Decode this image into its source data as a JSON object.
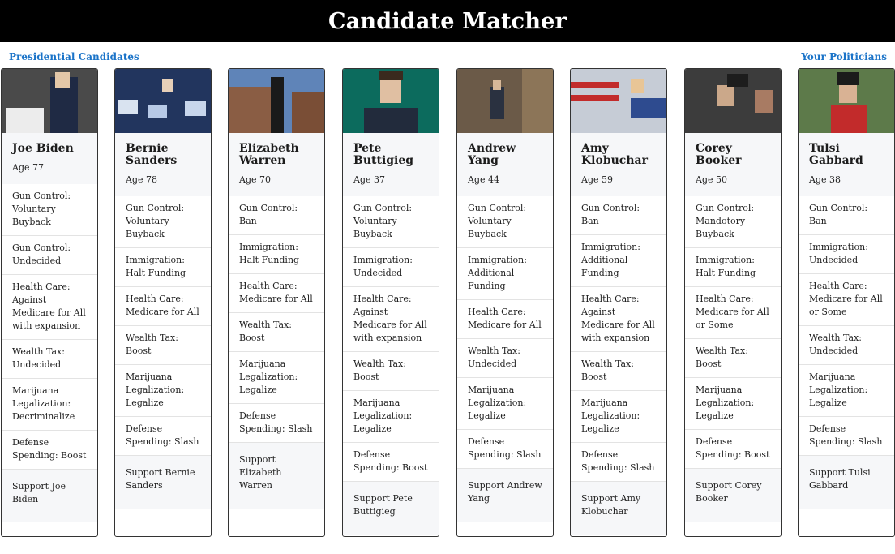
{
  "app": {
    "title": "Candidate Matcher"
  },
  "nav": {
    "left": "Presidential Candidates",
    "right": "Your Politicians"
  },
  "colors": {
    "header_bg": "#000000",
    "link": "#1a73c8",
    "panel_bg": "#f6f7f9"
  },
  "candidates": [
    {
      "name": "Joe Biden",
      "age": "Age 77",
      "policies": [
        "Gun Control: Voluntary Buyback",
        "Gun Control: Undecided",
        "Health Care: Against Medicare for All with expansion",
        "Wealth Tax: Undecided",
        "Marijuana Legalization: Decriminalize",
        "Defense Spending: Boost"
      ],
      "support": "Support Joe Biden"
    },
    {
      "name": "Bernie Sanders",
      "age": "Age 78",
      "policies": [
        "Gun Control: Voluntary Buyback",
        "Immigration: Halt Funding",
        "Health Care: Medicare for All",
        "Wealth Tax: Boost",
        "Marijuana Legalization: Legalize",
        "Defense Spending: Slash"
      ],
      "support": "Support Bernie Sanders"
    },
    {
      "name": "Elizabeth Warren",
      "age": "Age 70",
      "policies": [
        "Gun Control: Ban",
        "Immigration: Halt Funding",
        "Health Care: Medicare for All",
        "Wealth Tax: Boost",
        "Marijuana Legalization: Legalize",
        "Defense Spending: Slash"
      ],
      "support": "Support Elizabeth Warren"
    },
    {
      "name": "Pete Buttigieg",
      "age": "Age 37",
      "policies": [
        "Gun Control: Voluntary Buyback",
        "Immigration: Undecided",
        "Health Care: Against Medicare for All with expansion",
        "Wealth Tax: Boost",
        "Marijuana Legalization: Legalize",
        "Defense Spending: Boost"
      ],
      "support": "Support Pete Buttigieg"
    },
    {
      "name": "Andrew Yang",
      "age": "Age 44",
      "policies": [
        "Gun Control: Voluntary Buyback",
        "Immigration: Additional Funding",
        "Health Care: Medicare for All",
        "Wealth Tax: Undecided",
        "Marijuana Legalization: Legalize",
        "Defense Spending: Slash"
      ],
      "support": "Support Andrew Yang"
    },
    {
      "name": "Amy Klobuchar",
      "age": "Age 59",
      "policies": [
        "Gun Control: Ban",
        "Immigration: Additional Funding",
        "Health Care: Against Medicare for All with expansion",
        "Wealth Tax: Boost",
        "Marijuana Legalization: Legalize",
        "Defense Spending: Slash"
      ],
      "support": "Support Amy Klobuchar"
    },
    {
      "name": "Corey Booker",
      "age": "Age 50",
      "policies": [
        "Gun Control: Mandotory Buyback",
        "Immigration: Halt Funding",
        "Health Care: Medicare for All or Some",
        "Wealth Tax: Boost",
        "Marijuana Legalization: Legalize",
        "Defense Spending: Boost"
      ],
      "support": "Support Corey Booker"
    },
    {
      "name": "Tulsi Gabbard",
      "age": "Age 38",
      "policies": [
        "Gun Control: Ban",
        "Immigration: Undecided",
        "Health Care: Medicare for All or Some",
        "Wealth Tax: Undecided",
        "Marijuana Legalization: Legalize",
        "Defense Spending: Slash"
      ],
      "support": "Support Tulsi Gabbard"
    }
  ]
}
